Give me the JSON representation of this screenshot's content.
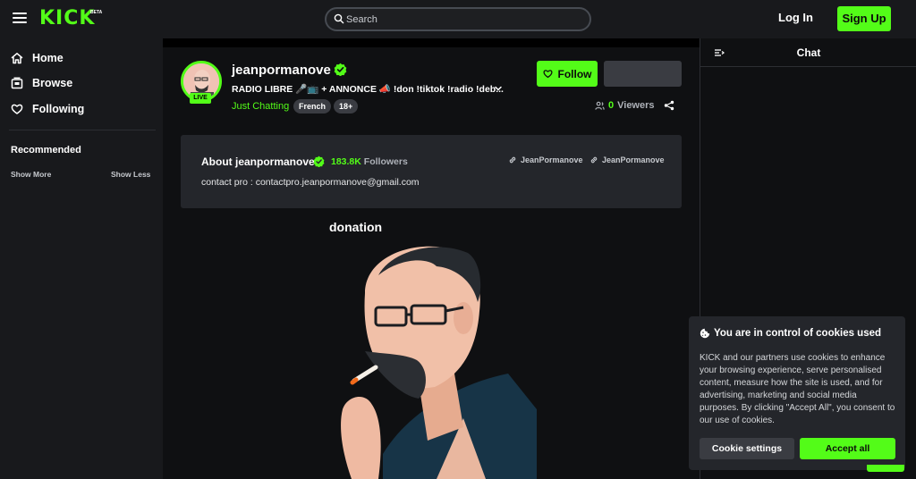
{
  "header": {
    "logo": "KICK",
    "logo_badge": "BETA",
    "search_placeholder": "Search",
    "login_label": "Log In",
    "signup_label": "Sign Up"
  },
  "sidebar": {
    "items": [
      {
        "label": "Home",
        "icon": "home-icon"
      },
      {
        "label": "Browse",
        "icon": "browse-icon"
      },
      {
        "label": "Following",
        "icon": "heart-icon"
      }
    ],
    "recommended_label": "Recommended",
    "show_more": "Show More",
    "show_less": "Show Less"
  },
  "channel": {
    "name": "jeanpormanove",
    "live_badge": "LIVE",
    "stream_title": "RADIO LIBRE 🎤📺 + ANNONCE 📣 !don !tiktok !radio !deb...",
    "category": "Just Chatting",
    "tags": [
      "French",
      "18+"
    ],
    "follow_label": "Follow",
    "viewers_count": "0",
    "viewers_label": "Viewers"
  },
  "about": {
    "title": "About jeanpormanove",
    "followers_count": "183.8K",
    "followers_label": "Followers",
    "socials": [
      "JeanPormanove",
      "JeanPormanove"
    ],
    "description": "contact pro : contactpro.jeanpormanove@gmail.com"
  },
  "donation_heading": "donation",
  "chat": {
    "title": "Chat"
  },
  "cookie": {
    "title": "You are in control of cookies used",
    "text": "KICK and our partners use cookies to enhance your browsing experience, serve personalised content, measure how the site is used, and for advertising, marketing and social media purposes. By clicking \"Accept All\", you consent to our use of cookies.",
    "settings_label": "Cookie settings",
    "accept_label": "Accept all"
  },
  "colors": {
    "accent": "#53fc18",
    "background": "#0f1012",
    "panel": "#18191c",
    "card": "#24262b"
  }
}
